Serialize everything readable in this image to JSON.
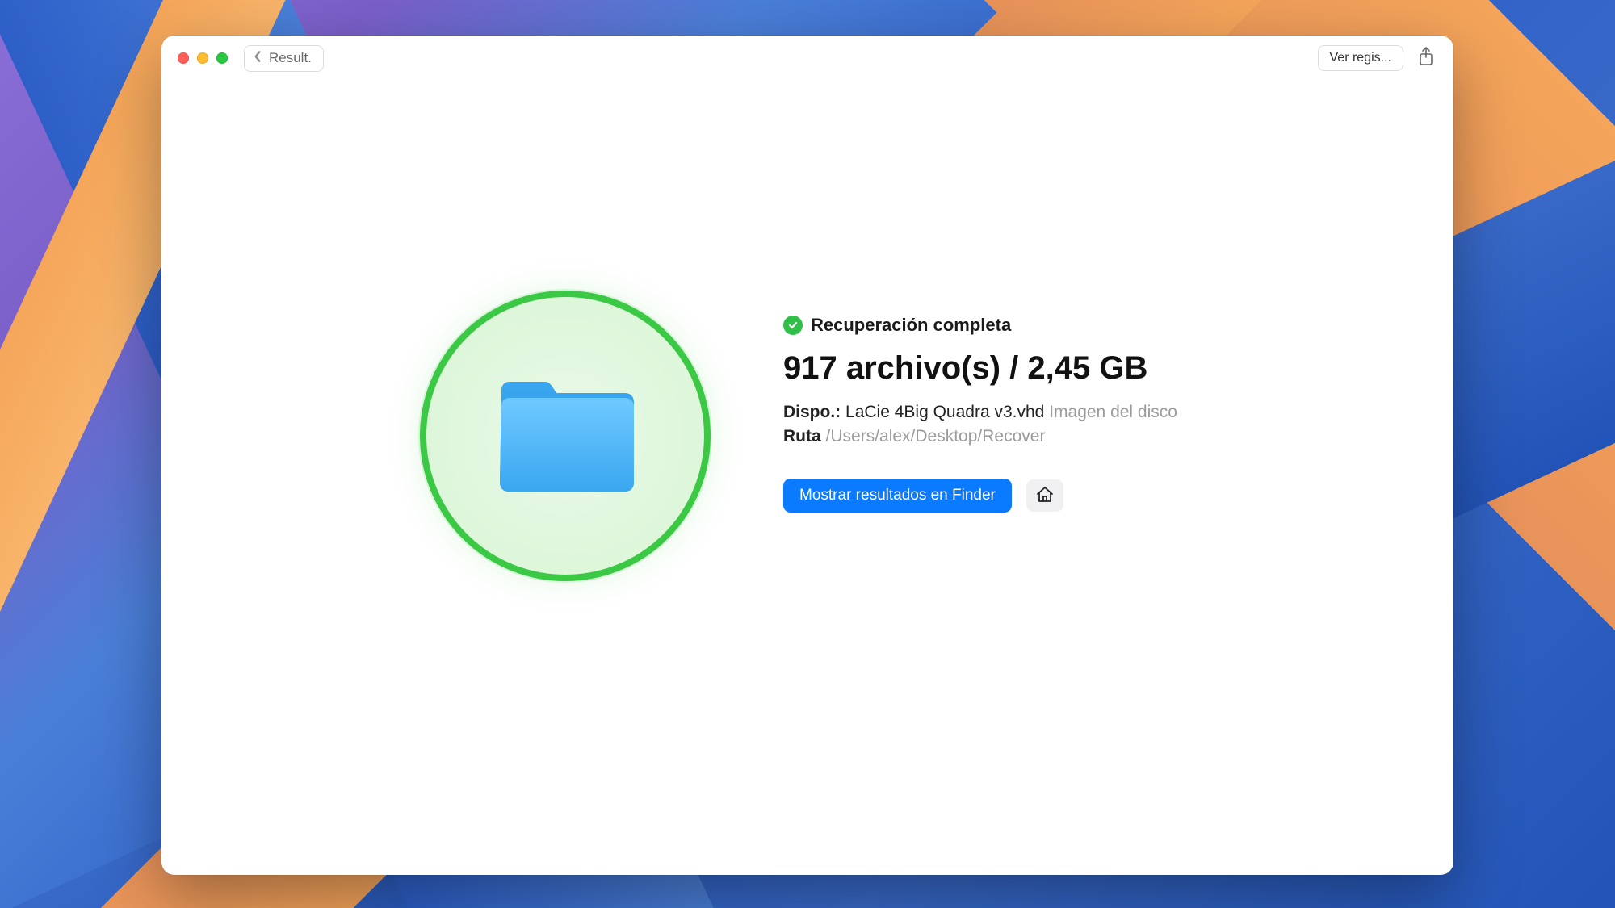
{
  "toolbar": {
    "back_label": "Result.",
    "view_log_label": "Ver regis..."
  },
  "status": {
    "text": "Recuperación completa"
  },
  "headline": "917 archivo(s) / 2,45 GB",
  "device": {
    "label": "Dispo.:",
    "name": "LaCie 4Big Quadra v3.vhd",
    "type": "Imagen del disco"
  },
  "path": {
    "label": "Ruta",
    "value": "/Users/alex/Desktop/Recover"
  },
  "actions": {
    "show_in_finder": "Mostrar resultados en Finder"
  }
}
